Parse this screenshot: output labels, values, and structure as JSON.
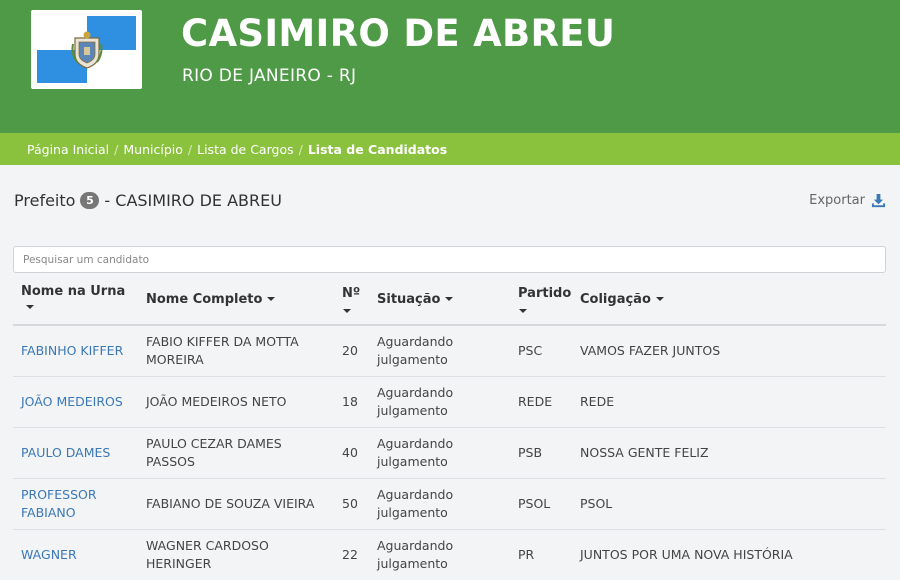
{
  "header": {
    "city": "CASIMIRO DE ABREU",
    "state": "RIO DE JANEIRO - RJ"
  },
  "breadcrumb": {
    "items": [
      "Página Inicial",
      "Município",
      "Lista de Cargos"
    ],
    "active": "Lista de Candidatos"
  },
  "page": {
    "title_prefix": "Prefeito",
    "count": "5",
    "title_suffix": "- CASIMIRO DE ABREU",
    "export_label": "Exportar"
  },
  "search": {
    "placeholder": "Pesquisar um candidato",
    "value": ""
  },
  "table": {
    "headers": {
      "nome_urna": "Nome na Urna",
      "nome_completo": "Nome Completo",
      "numero": "Nº",
      "situacao": "Situação",
      "partido": "Partido",
      "coligacao": "Coligação"
    },
    "rows": [
      {
        "nome_urna": "FABINHO KIFFER",
        "nome_completo": "FABIO KIFFER DA MOTTA MOREIRA",
        "numero": "20",
        "situacao": "Aguardando julgamento",
        "partido": "PSC",
        "coligacao": "VAMOS FAZER JUNTOS"
      },
      {
        "nome_urna": "JOÃO MEDEIROS",
        "nome_completo": "JOÃO MEDEIROS NETO",
        "numero": "18",
        "situacao": "Aguardando julgamento",
        "partido": "REDE",
        "coligacao": "REDE"
      },
      {
        "nome_urna": "PAULO DAMES",
        "nome_completo": "PAULO CEZAR DAMES PASSOS",
        "numero": "40",
        "situacao": "Aguardando julgamento",
        "partido": "PSB",
        "coligacao": "NOSSA GENTE FELIZ"
      },
      {
        "nome_urna": "PROFESSOR FABIANO",
        "nome_completo": "FABIANO DE SOUZA VIEIRA",
        "numero": "50",
        "situacao": "Aguardando julgamento",
        "partido": "PSOL",
        "coligacao": "PSOL"
      },
      {
        "nome_urna": "WAGNER",
        "nome_completo": "WAGNER CARDOSO HERINGER",
        "numero": "22",
        "situacao": "Aguardando julgamento",
        "partido": "PR",
        "coligacao": "JUNTOS POR UMA NOVA HISTÓRIA"
      }
    ]
  },
  "colors": {
    "header_green": "#4f9a47",
    "breadcrumb_green": "#8ac23e",
    "link_blue": "#3b78b5",
    "flag_blue": "#2f8fe0"
  },
  "icons": {
    "export": "download-icon",
    "flag": "municipal-flag-icon"
  }
}
